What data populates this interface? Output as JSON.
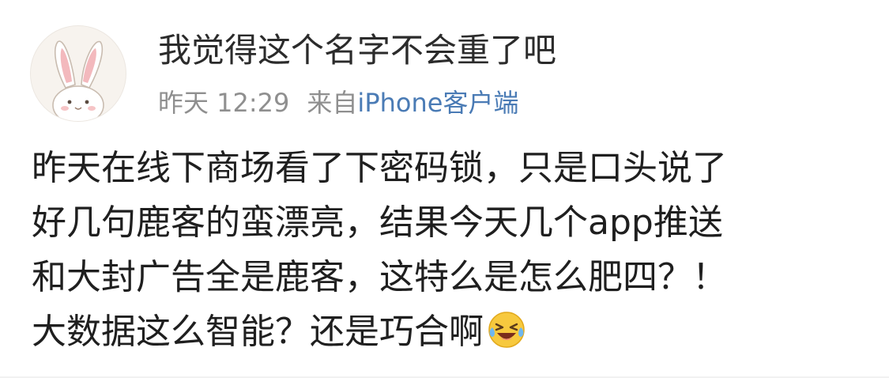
{
  "post": {
    "username": "我觉得这个名字不会重了吧",
    "time": "昨天 12:29",
    "source_prefix": "来自",
    "source_app": "iPhone客户端",
    "content_lines": [
      "昨天在线下商场看了下密码锁，只是口头说了",
      "好几句鹿客的蛮漂亮，结果今天几个app推送",
      "和大封广告全是鹿客，这特么是怎么肥四？！",
      "大数据这么智能？还是巧合啊"
    ],
    "avatar_icon": "bunny-avatar-icon",
    "emoji_icon": "laugh-cry-emoji-icon"
  },
  "colors": {
    "username": "#2b2b2b",
    "meta": "#8f8f8f",
    "source_link": "#4a7bb5",
    "content": "#1f1f1f"
  }
}
